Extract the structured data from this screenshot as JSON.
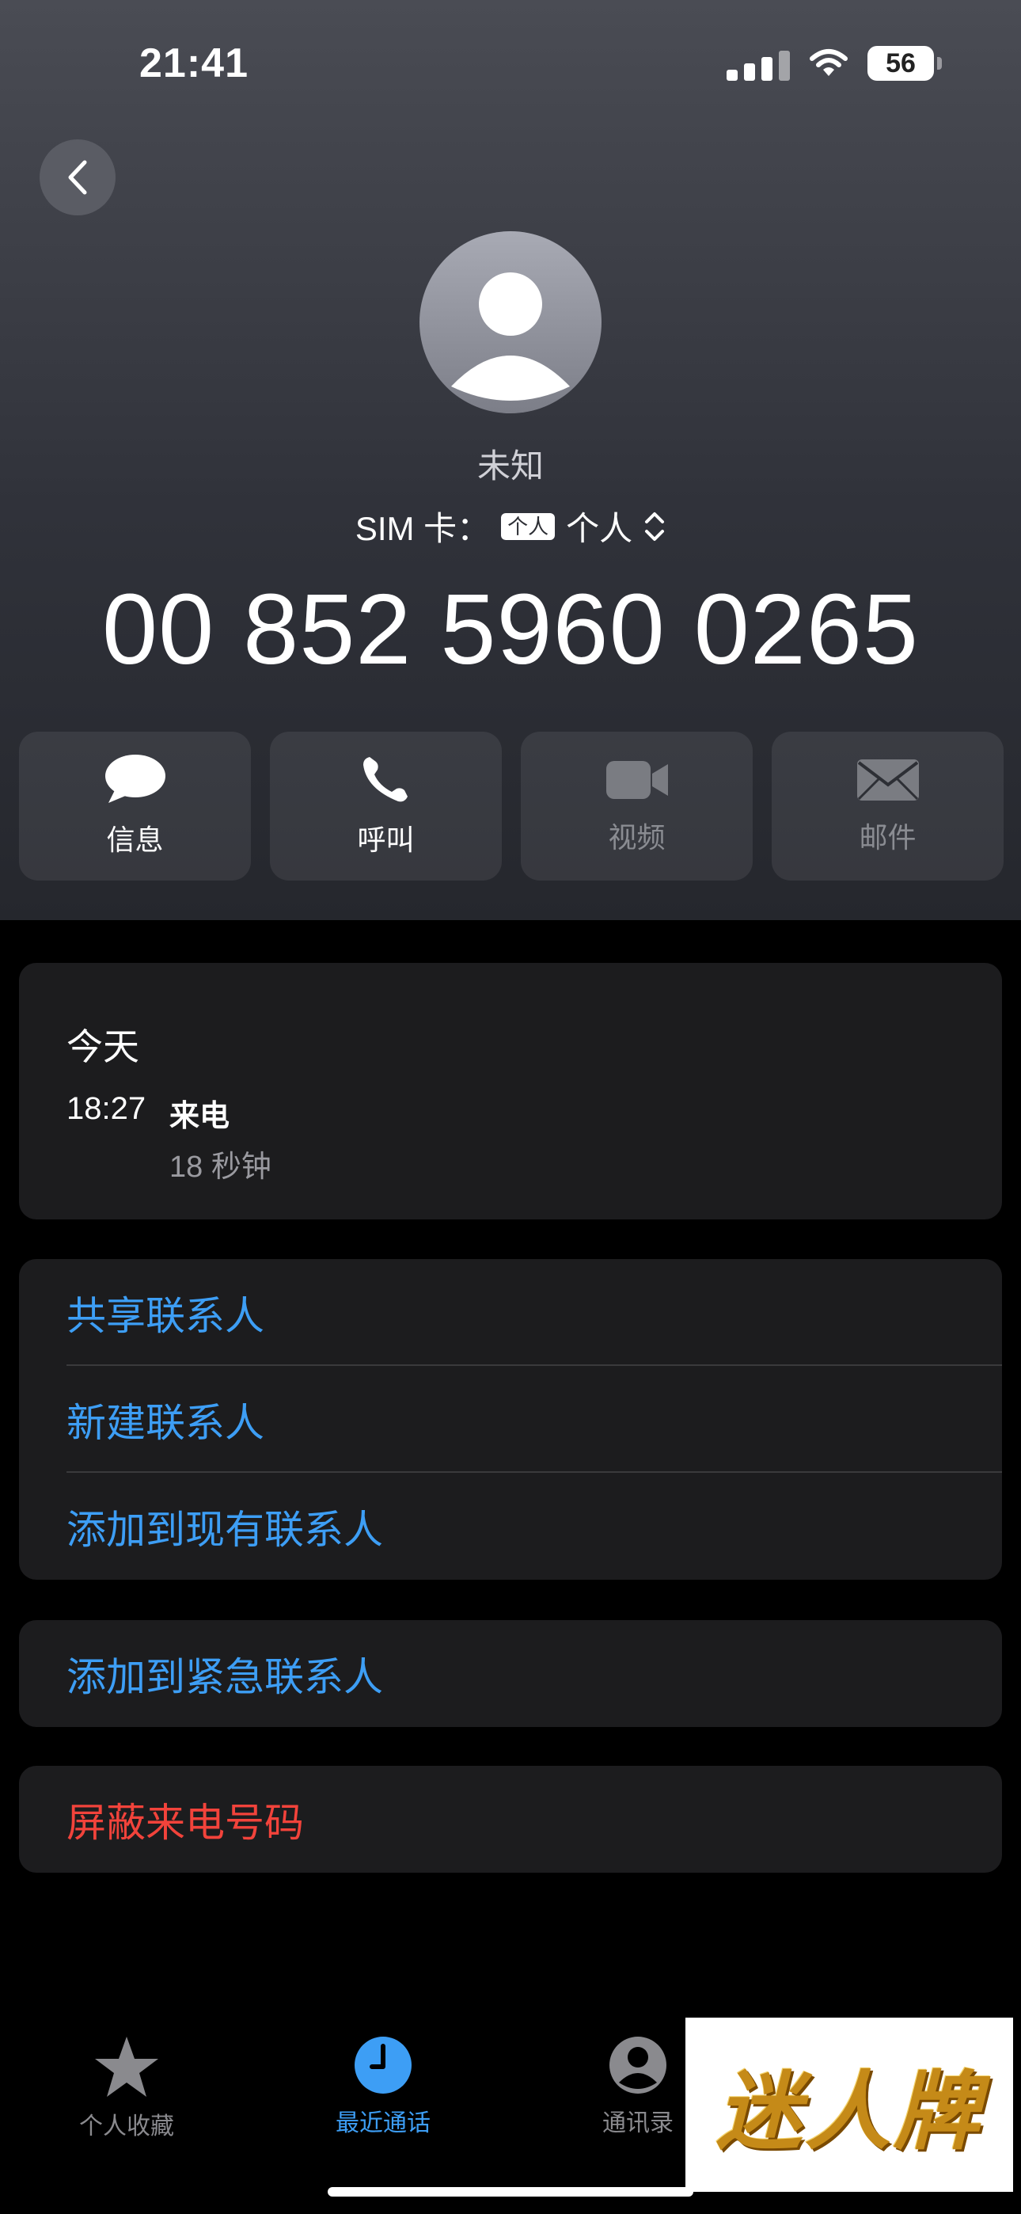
{
  "status_bar": {
    "time": "21:41",
    "battery": "56"
  },
  "contact": {
    "name": "未知",
    "sim_label": "SIM 卡：",
    "sim_badge": "个人",
    "sim_value": "个人",
    "number": "00 852 5960 0265"
  },
  "actions": [
    {
      "label": "信息",
      "icon": "message-bubble-icon",
      "enabled": true
    },
    {
      "label": "呼叫",
      "icon": "phone-icon",
      "enabled": true
    },
    {
      "label": "视频",
      "icon": "video-camera-icon",
      "enabled": false
    },
    {
      "label": "邮件",
      "icon": "mail-icon",
      "enabled": false
    }
  ],
  "history": {
    "day": "今天",
    "time": "18:27",
    "type": "来电",
    "duration": "18 秒钟"
  },
  "menu": {
    "share": "共享联系人",
    "new_contact": "新建联系人",
    "add_existing": "添加到现有联系人",
    "add_emergency": "添加到紧急联系人",
    "block": "屏蔽来电号码"
  },
  "tabs": [
    {
      "label": "个人收藏",
      "icon": "star-icon",
      "active": false
    },
    {
      "label": "最近通话",
      "icon": "clock-icon",
      "active": true
    },
    {
      "label": "通讯录",
      "icon": "person-circle-icon",
      "active": false
    }
  ],
  "watermark": {
    "text": "迷人牌"
  },
  "colors": {
    "accent": "#3d9ef5",
    "destructive": "#f2433b"
  }
}
